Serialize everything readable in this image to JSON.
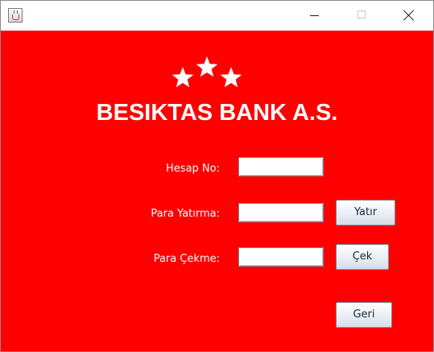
{
  "window": {
    "title": "",
    "app_icon": "java-cup-icon",
    "controls": {
      "minimize": "minimize-icon",
      "maximize": "maximize-icon",
      "close": "close-icon"
    }
  },
  "header": {
    "stars": 3,
    "star_icon": "star-icon",
    "title": "BESIKTAS BANK A.S."
  },
  "form": {
    "account_no": {
      "label": "Hesap No:",
      "value": ""
    },
    "deposit": {
      "label": "Para Yatırma:",
      "value": "",
      "button_label": "Yatır"
    },
    "withdraw": {
      "label": "Para Çekme:",
      "value": "",
      "button_label": "Çek"
    },
    "back_button_label": "Geri"
  },
  "colors": {
    "background": "#ff0000",
    "text": "#ffffff"
  }
}
